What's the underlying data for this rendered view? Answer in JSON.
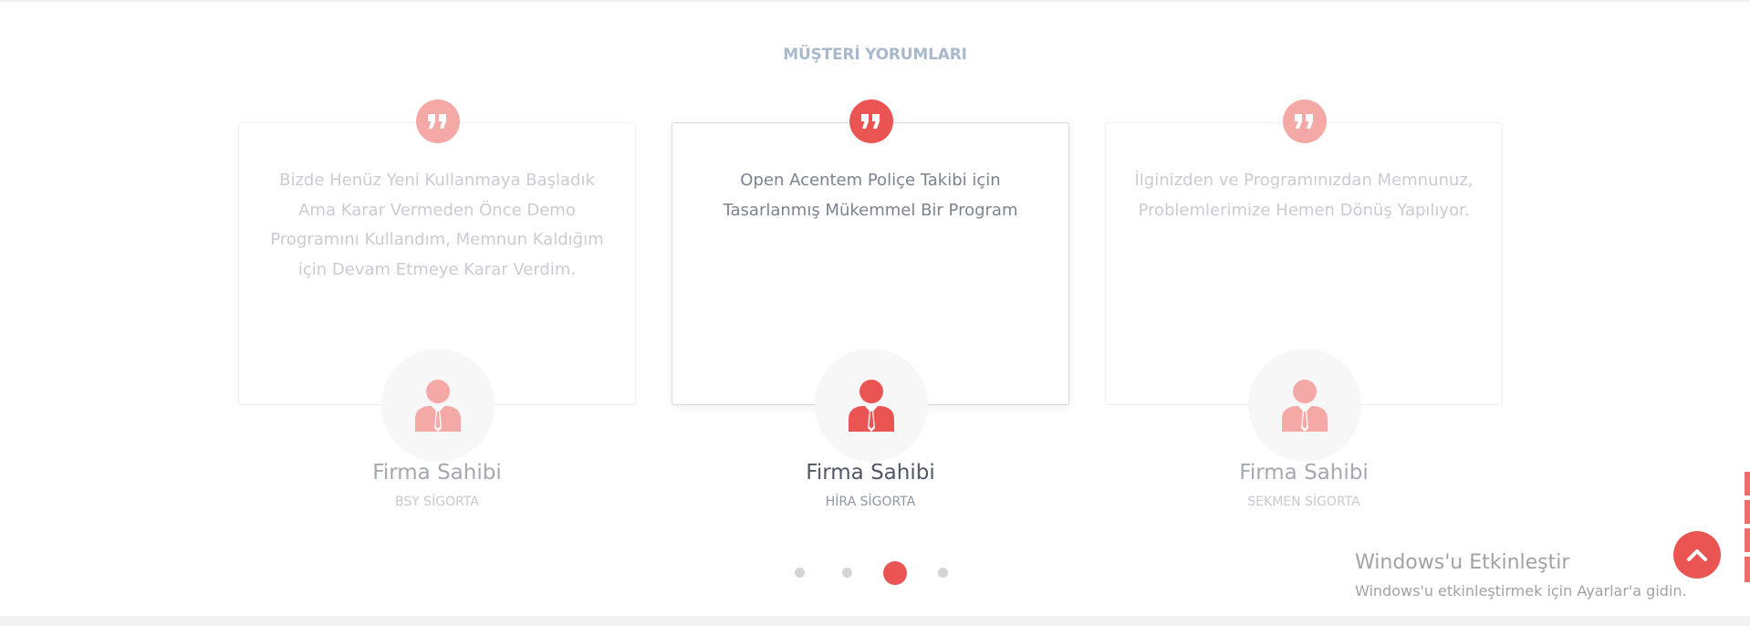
{
  "section": {
    "title": "MÜŞTERİ YORUMLARI"
  },
  "testimonials": [
    {
      "text": "Bizde Henüz Yeni Kullanmaya Başladık Ama Karar Vermeden Önce Demo Programını Kullandım, Memnun Kaldığım için Devam Etmeye Karar Verdim.",
      "name": "Firma Sahibi",
      "company": "BSY SİGORTA",
      "active": false
    },
    {
      "text": "Open Acentem Poliçe Takibi için Tasarlanmış Mükemmel Bir Program",
      "name": "Firma Sahibi",
      "company": "HİRA SİGORTA",
      "active": true
    },
    {
      "text": "İlginizden ve Programınızdan Memnunuz, Problemlerimize Hemen Dönüş Yapılıyor.",
      "name": "Firma Sahibi",
      "company": "SEKMEN SİGORTA",
      "active": false
    }
  ],
  "pagination": {
    "count": 4,
    "active_index": 2
  },
  "icons": {
    "quote": "quote-icon",
    "avatar": "businessman-icon",
    "scroll_top": "chevron-up-icon"
  },
  "colors": {
    "accent": "#ea5452",
    "accent_light": "#f4a9a7",
    "title": "#a9b9cc"
  },
  "watermark": {
    "title": "Windows'u Etkinleştir",
    "subtitle": "Windows'u etkinleştirmek için Ayarlar'a gidin."
  }
}
